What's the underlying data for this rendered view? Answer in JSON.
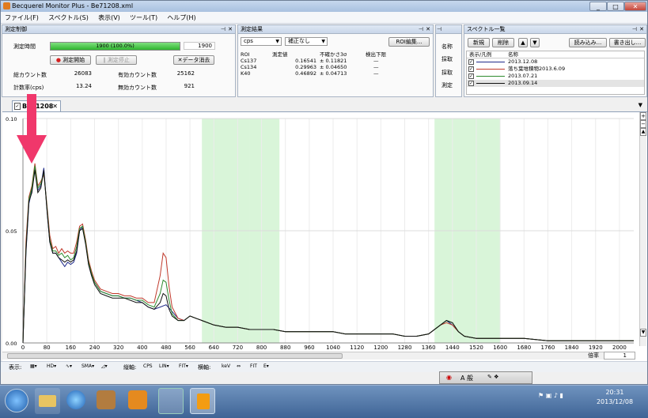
{
  "window": {
    "title": "Becquerel Monitor Plus - Be71208.xml"
  },
  "menu": [
    "ファイル(F)",
    "スペクトル(S)",
    "表示(V)",
    "ツール(T)",
    "ヘルプ(H)"
  ],
  "control_panel": {
    "title": "測定制御",
    "time_label": "測定時間",
    "progress_text": "1900 (100.0%)",
    "progress": 1.0,
    "time_value": "1900",
    "start_button": "測定開始",
    "stop_button": "測定停止",
    "clear_button": "データ消去",
    "total_count_label": "総カウント数",
    "total_count": "26083",
    "valid_count_label": "有効カウント数",
    "valid_count": "25162",
    "rate_label": "計数率(cps)",
    "rate": "13.24",
    "invalid_count_label": "無効カウント数",
    "invalid_count": "921"
  },
  "results_panel": {
    "title": "測定結果",
    "unit_select": "cps",
    "correction_select": "補正なし",
    "roi_edit_button": "ROI編集...",
    "columns": [
      "ROI",
      "測定値",
      "不確かさ3σ",
      "検出下限"
    ],
    "rows": [
      [
        "Cs137",
        "0.16541",
        "± 0.11821",
        "—"
      ],
      [
        "Cs134",
        "0.29963",
        "± 0.04650",
        "—"
      ],
      [
        "K40",
        "0.46892",
        "± 0.04713",
        "—"
      ]
    ]
  },
  "side_panel": {
    "items": [
      "名称",
      "採取",
      "採取",
      "測定"
    ]
  },
  "spectrum_list": {
    "title": "スペクトル一覧",
    "new_button": "新規",
    "delete_button": "削除",
    "load_button": "読み込み...",
    "write_button": "書き出し...",
    "columns": [
      "表示/凡例",
      "名称"
    ],
    "items": [
      {
        "name": "2013.12.08",
        "color": "#1f2a8a"
      },
      {
        "name": "落ち葉堆積物2013.6.09",
        "color": "#c0392b"
      },
      {
        "name": "2013.07.21",
        "color": "#2e8b2e"
      },
      {
        "name": "2013.09.14",
        "color": "#111111"
      }
    ]
  },
  "document_tab": {
    "label": "Be71208"
  },
  "chart_data": {
    "type": "line",
    "xlim": [
      0,
      2048
    ],
    "ylim": [
      0,
      0.1
    ],
    "x_ticks": [
      "0",
      "80",
      "160",
      "240",
      "320",
      "400",
      "480",
      "560",
      "640",
      "720",
      "800",
      "880",
      "960",
      "1040",
      "1120",
      "1200",
      "1280",
      "1360",
      "1440",
      "1520",
      "1600",
      "1680",
      "1760",
      "1840",
      "1920",
      "2000"
    ],
    "y_ticks": [
      "0.00",
      "0.05",
      "0.10"
    ],
    "roi_bands": [
      [
        600,
        760
      ],
      [
        760,
        860
      ],
      [
        1380,
        1600
      ]
    ],
    "roi_color": "#d9f5d9",
    "series": [
      {
        "name": "2013.12.08",
        "color": "#1f2a8a",
        "x": [
          0,
          10,
          20,
          30,
          40,
          50,
          60,
          70,
          80,
          90,
          100,
          110,
          120,
          130,
          140,
          150,
          160,
          170,
          180,
          190,
          200,
          210,
          220,
          230,
          240,
          260,
          280,
          300,
          320,
          340,
          360,
          380,
          400,
          420,
          440,
          460,
          480,
          500,
          520,
          540,
          560,
          580,
          600,
          640,
          680,
          720,
          760,
          800,
          840,
          880,
          920,
          960,
          1000,
          1040,
          1080,
          1120,
          1160,
          1200,
          1240,
          1280,
          1320,
          1360,
          1400,
          1420,
          1440,
          1460,
          1480,
          1520,
          1560,
          1600,
          1680,
          1760,
          1840,
          1920,
          2000,
          2048
        ],
        "y": [
          0.0,
          0.04,
          0.062,
          0.068,
          0.078,
          0.068,
          0.07,
          0.078,
          0.06,
          0.045,
          0.04,
          0.04,
          0.038,
          0.036,
          0.034,
          0.036,
          0.035,
          0.036,
          0.04,
          0.05,
          0.052,
          0.045,
          0.035,
          0.03,
          0.027,
          0.023,
          0.022,
          0.021,
          0.021,
          0.02,
          0.02,
          0.019,
          0.018,
          0.016,
          0.015,
          0.016,
          0.017,
          0.014,
          0.011,
          0.01,
          0.012,
          0.011,
          0.01,
          0.008,
          0.007,
          0.007,
          0.006,
          0.006,
          0.006,
          0.005,
          0.005,
          0.005,
          0.005,
          0.005,
          0.004,
          0.004,
          0.004,
          0.004,
          0.004,
          0.003,
          0.003,
          0.004,
          0.008,
          0.01,
          0.008,
          0.005,
          0.003,
          0.002,
          0.002,
          0.002,
          0.002,
          0.001,
          0.001,
          0.001,
          0.001,
          0.001
        ]
      },
      {
        "name": "落ち葉堆積物2013.6.09",
        "color": "#c0392b",
        "x": [
          0,
          10,
          20,
          30,
          40,
          50,
          60,
          70,
          80,
          90,
          100,
          110,
          120,
          130,
          140,
          150,
          160,
          170,
          180,
          190,
          200,
          210,
          220,
          230,
          240,
          260,
          280,
          300,
          320,
          340,
          360,
          380,
          400,
          420,
          440,
          460,
          470,
          480,
          490,
          500,
          520,
          540,
          560,
          580,
          600,
          640,
          680,
          720,
          760,
          800,
          840,
          880,
          920,
          960,
          1000,
          1040,
          1080,
          1120,
          1160,
          1200,
          1240,
          1280,
          1320,
          1360,
          1400,
          1420,
          1440,
          1460,
          1480,
          1520,
          1560,
          1600,
          1680,
          1760,
          1840,
          1920,
          2000,
          2048
        ],
        "y": [
          0.0,
          0.045,
          0.065,
          0.07,
          0.08,
          0.07,
          0.072,
          0.075,
          0.062,
          0.048,
          0.042,
          0.043,
          0.04,
          0.042,
          0.04,
          0.041,
          0.04,
          0.04,
          0.045,
          0.052,
          0.053,
          0.046,
          0.037,
          0.032,
          0.028,
          0.024,
          0.023,
          0.022,
          0.022,
          0.021,
          0.021,
          0.02,
          0.02,
          0.018,
          0.018,
          0.03,
          0.04,
          0.038,
          0.025,
          0.016,
          0.011,
          0.01,
          0.012,
          0.011,
          0.01,
          0.008,
          0.007,
          0.007,
          0.006,
          0.006,
          0.006,
          0.005,
          0.005,
          0.005,
          0.005,
          0.005,
          0.004,
          0.004,
          0.004,
          0.004,
          0.004,
          0.003,
          0.003,
          0.004,
          0.008,
          0.009,
          0.008,
          0.005,
          0.003,
          0.002,
          0.002,
          0.002,
          0.002,
          0.001,
          0.001,
          0.001,
          0.001,
          0.001
        ]
      },
      {
        "name": "2013.07.21",
        "color": "#2e8b2e",
        "x": [
          0,
          10,
          20,
          30,
          40,
          50,
          60,
          70,
          80,
          90,
          100,
          110,
          120,
          130,
          140,
          150,
          160,
          170,
          180,
          190,
          200,
          210,
          220,
          230,
          240,
          260,
          280,
          300,
          320,
          340,
          360,
          380,
          400,
          420,
          440,
          460,
          470,
          480,
          490,
          500,
          520,
          540,
          560,
          580,
          600,
          640,
          680,
          720,
          760,
          800,
          840,
          880,
          920,
          960,
          1000,
          1040,
          1080,
          1120,
          1160,
          1200,
          1240,
          1280,
          1320,
          1360,
          1400,
          1420,
          1440,
          1460,
          1480,
          1520,
          1560,
          1600,
          1680,
          1760,
          1840,
          1920,
          2000,
          2048
        ],
        "y": [
          0.0,
          0.042,
          0.064,
          0.069,
          0.079,
          0.069,
          0.071,
          0.076,
          0.061,
          0.046,
          0.041,
          0.041,
          0.039,
          0.04,
          0.038,
          0.039,
          0.037,
          0.038,
          0.043,
          0.051,
          0.052,
          0.045,
          0.036,
          0.031,
          0.027,
          0.023,
          0.022,
          0.021,
          0.021,
          0.02,
          0.02,
          0.019,
          0.019,
          0.017,
          0.016,
          0.022,
          0.028,
          0.027,
          0.019,
          0.013,
          0.01,
          0.01,
          0.012,
          0.011,
          0.01,
          0.008,
          0.007,
          0.007,
          0.006,
          0.006,
          0.006,
          0.005,
          0.005,
          0.005,
          0.005,
          0.005,
          0.004,
          0.004,
          0.004,
          0.004,
          0.004,
          0.003,
          0.003,
          0.004,
          0.008,
          0.01,
          0.009,
          0.005,
          0.003,
          0.002,
          0.002,
          0.002,
          0.002,
          0.001,
          0.001,
          0.001,
          0.001,
          0.001
        ]
      },
      {
        "name": "2013.09.14",
        "color": "#111111",
        "x": [
          0,
          10,
          20,
          30,
          40,
          50,
          60,
          70,
          80,
          90,
          100,
          110,
          120,
          130,
          140,
          150,
          160,
          170,
          180,
          190,
          200,
          210,
          220,
          230,
          240,
          260,
          280,
          300,
          320,
          340,
          360,
          380,
          400,
          420,
          440,
          460,
          470,
          480,
          490,
          500,
          520,
          540,
          560,
          580,
          600,
          640,
          680,
          720,
          760,
          800,
          840,
          880,
          920,
          960,
          1000,
          1040,
          1080,
          1120,
          1160,
          1200,
          1240,
          1280,
          1320,
          1360,
          1400,
          1420,
          1440,
          1460,
          1480,
          1520,
          1560,
          1600,
          1680,
          1760,
          1840,
          1920,
          2000,
          2048
        ],
        "y": [
          0.0,
          0.041,
          0.063,
          0.067,
          0.077,
          0.067,
          0.069,
          0.077,
          0.06,
          0.045,
          0.04,
          0.04,
          0.038,
          0.037,
          0.036,
          0.037,
          0.036,
          0.037,
          0.041,
          0.05,
          0.051,
          0.044,
          0.035,
          0.03,
          0.026,
          0.022,
          0.021,
          0.02,
          0.02,
          0.02,
          0.019,
          0.018,
          0.018,
          0.016,
          0.015,
          0.018,
          0.022,
          0.021,
          0.015,
          0.012,
          0.01,
          0.01,
          0.012,
          0.011,
          0.01,
          0.008,
          0.007,
          0.007,
          0.006,
          0.006,
          0.006,
          0.005,
          0.005,
          0.005,
          0.005,
          0.005,
          0.004,
          0.004,
          0.004,
          0.004,
          0.004,
          0.003,
          0.003,
          0.004,
          0.008,
          0.01,
          0.009,
          0.005,
          0.003,
          0.002,
          0.002,
          0.002,
          0.002,
          0.001,
          0.001,
          0.001,
          0.001,
          0.001
        ]
      }
    ]
  },
  "bottom_toolbar": {
    "display_label": "表示:",
    "vertical_label": "縦軸:",
    "vertical_unit": "CPS",
    "horizontal_label": "横軸:",
    "horizontal_unit": "keV",
    "zoom_label": "倍率",
    "zoom_value": "1"
  },
  "ime_bar": {
    "mode": "A 般"
  },
  "clock": {
    "time": "20:31",
    "date": "2013/12/08"
  }
}
